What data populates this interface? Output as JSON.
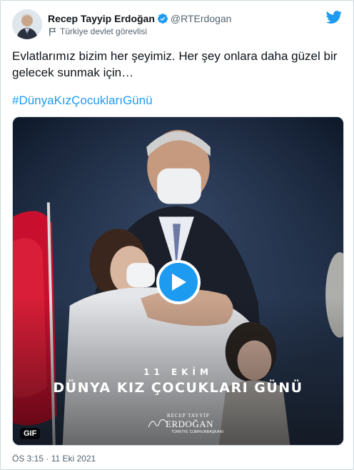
{
  "author": {
    "name": "Recep Tayyip Erdoğan",
    "handle": "@RTErdogan",
    "label": "Türkiye devlet görevlisi",
    "verified_icon": "verified-badge-icon",
    "label_icon": "flag-icon"
  },
  "brand": {
    "icon": "twitter-bird-icon",
    "color": "#1d9bf0"
  },
  "tweet": {
    "text": "Evlatlarımız bizim her şeyimiz. Her şey onlara daha güzel bir gelecek sunmak için…",
    "hashtag": "#DünyaKızÇocuklarıGünü",
    "timestamp": "ÖS 3:15 · 11 Eki 2021"
  },
  "media": {
    "type_badge": "GIF",
    "play_icon": "play-icon",
    "overlay_date": "11 EKİM",
    "overlay_title": "DÜNYA KIZ ÇOCUKLARI GÜNÜ",
    "signature_line1": "RECEP TAYYİP",
    "signature_line2": "ERDOĞAN",
    "signature_line3": "TÜRKİYE CUMHURBAŞKANI"
  },
  "colors": {
    "text": "#0f1419",
    "secondary": "#536471",
    "link": "#1d9bf0",
    "border": "#cfd9de"
  }
}
